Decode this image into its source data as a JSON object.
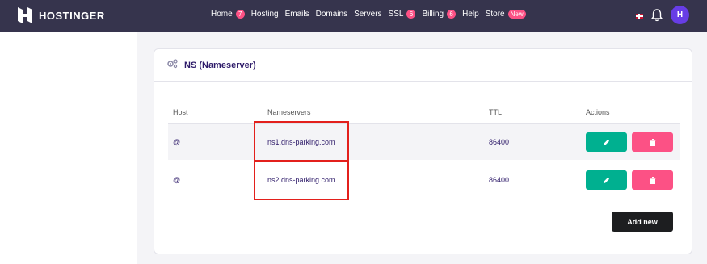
{
  "brand": {
    "name": "HOSTINGER"
  },
  "nav": {
    "items": [
      {
        "label": "Home",
        "badge": "7"
      },
      {
        "label": "Hosting",
        "badge": ""
      },
      {
        "label": "Emails",
        "badge": ""
      },
      {
        "label": "Domains",
        "badge": ""
      },
      {
        "label": "Servers",
        "badge": ""
      },
      {
        "label": "SSL",
        "badge": "6"
      },
      {
        "label": "Billing",
        "badge": "6"
      },
      {
        "label": "Help",
        "badge": ""
      },
      {
        "label": "Store",
        "badge": "New"
      }
    ]
  },
  "header_icons": {
    "flag": "uk-flag-icon",
    "bell": "bell-icon",
    "avatar_letter": "H"
  },
  "card": {
    "title": "NS (Nameserver)",
    "icon": "gears-icon",
    "columns": {
      "host": "Host",
      "nameservers": "Nameservers",
      "ttl": "TTL",
      "actions": "Actions"
    },
    "rows": [
      {
        "host": "@",
        "nameserver": "ns1.dns-parking.com",
        "ttl": "86400"
      },
      {
        "host": "@",
        "nameserver": "ns2.dns-parking.com",
        "ttl": "86400"
      }
    ],
    "add_button": "Add new"
  },
  "colors": {
    "topbar": "#36344d",
    "badge": "#fc5185",
    "edit": "#00b090",
    "delete": "#fc5185",
    "highlight": "#e3201c",
    "primary_text": "#2f1c6a"
  }
}
